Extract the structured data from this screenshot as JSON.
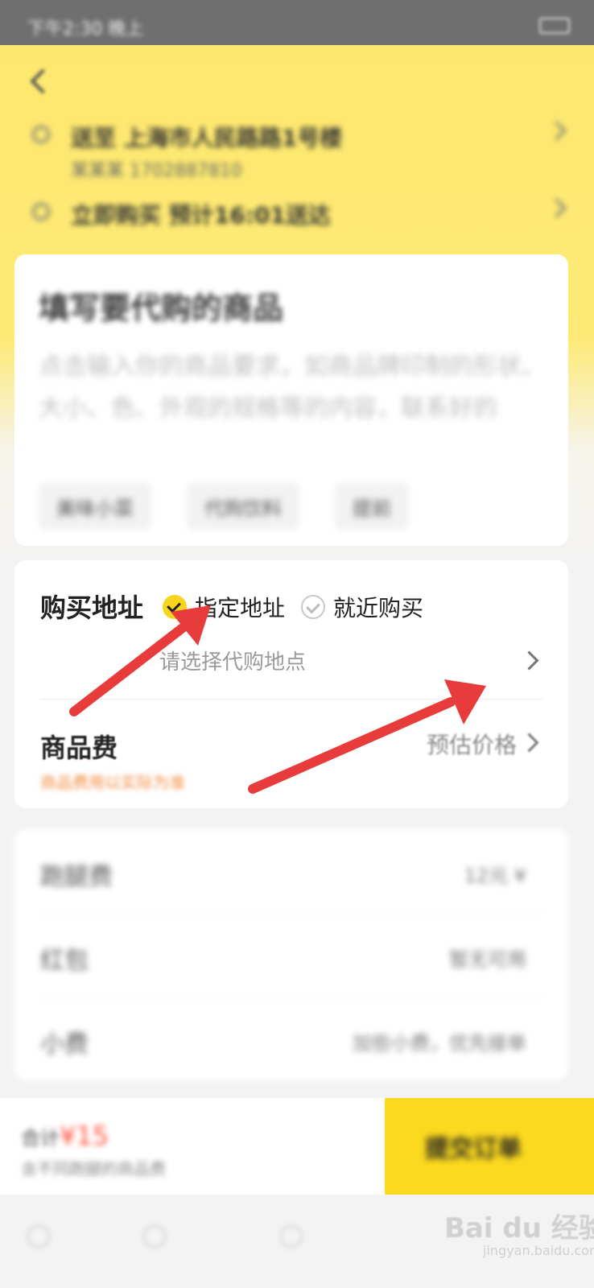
{
  "status_bar": {
    "time": "下午2:30 晚上"
  },
  "header": {
    "delivery_address": {
      "text": "送至 上海市人民路路1号楼",
      "sub": "某某某 1702887810"
    },
    "delivery_time": {
      "text": "立即购买 预计16:01送达"
    }
  },
  "goods_card": {
    "title": "填写要代购的商品",
    "description": "点击输入你的商品要求，如商品牌印制的形状、大小、色、外观的规格等的内容，联系好的",
    "chips": [
      "美味小菜",
      "代购饮料",
      "提前"
    ]
  },
  "purchase": {
    "label": "购买地址",
    "options": [
      {
        "label": "指定地址",
        "checked": true
      },
      {
        "label": "就近购买",
        "checked": false
      }
    ],
    "location_placeholder": "请选择代购地点",
    "goods_fee_label": "商品费",
    "goods_fee_sub": "商品费用以实际为准",
    "goods_fee_right": "预估价格"
  },
  "misc_rows": [
    {
      "label": "跑腿费",
      "value": "12元 ¥"
    },
    {
      "label": "红包",
      "value": "暂无可用"
    },
    {
      "label": "小费",
      "value": "加些小费，优先接单"
    }
  ],
  "bottom_bar": {
    "price_prefix": "合计",
    "price": "¥15",
    "price_sub": "含不同跑腿的商品费",
    "submit_label": "提交订单"
  },
  "watermark": {
    "brand": "Bai du 经验",
    "sub": "jingyan.baidu.com"
  },
  "colors": {
    "accent": "#f7d51e",
    "header_bg": "#fde86e",
    "arrow": "#e83c3c",
    "price_red": "#ff4d3a"
  }
}
